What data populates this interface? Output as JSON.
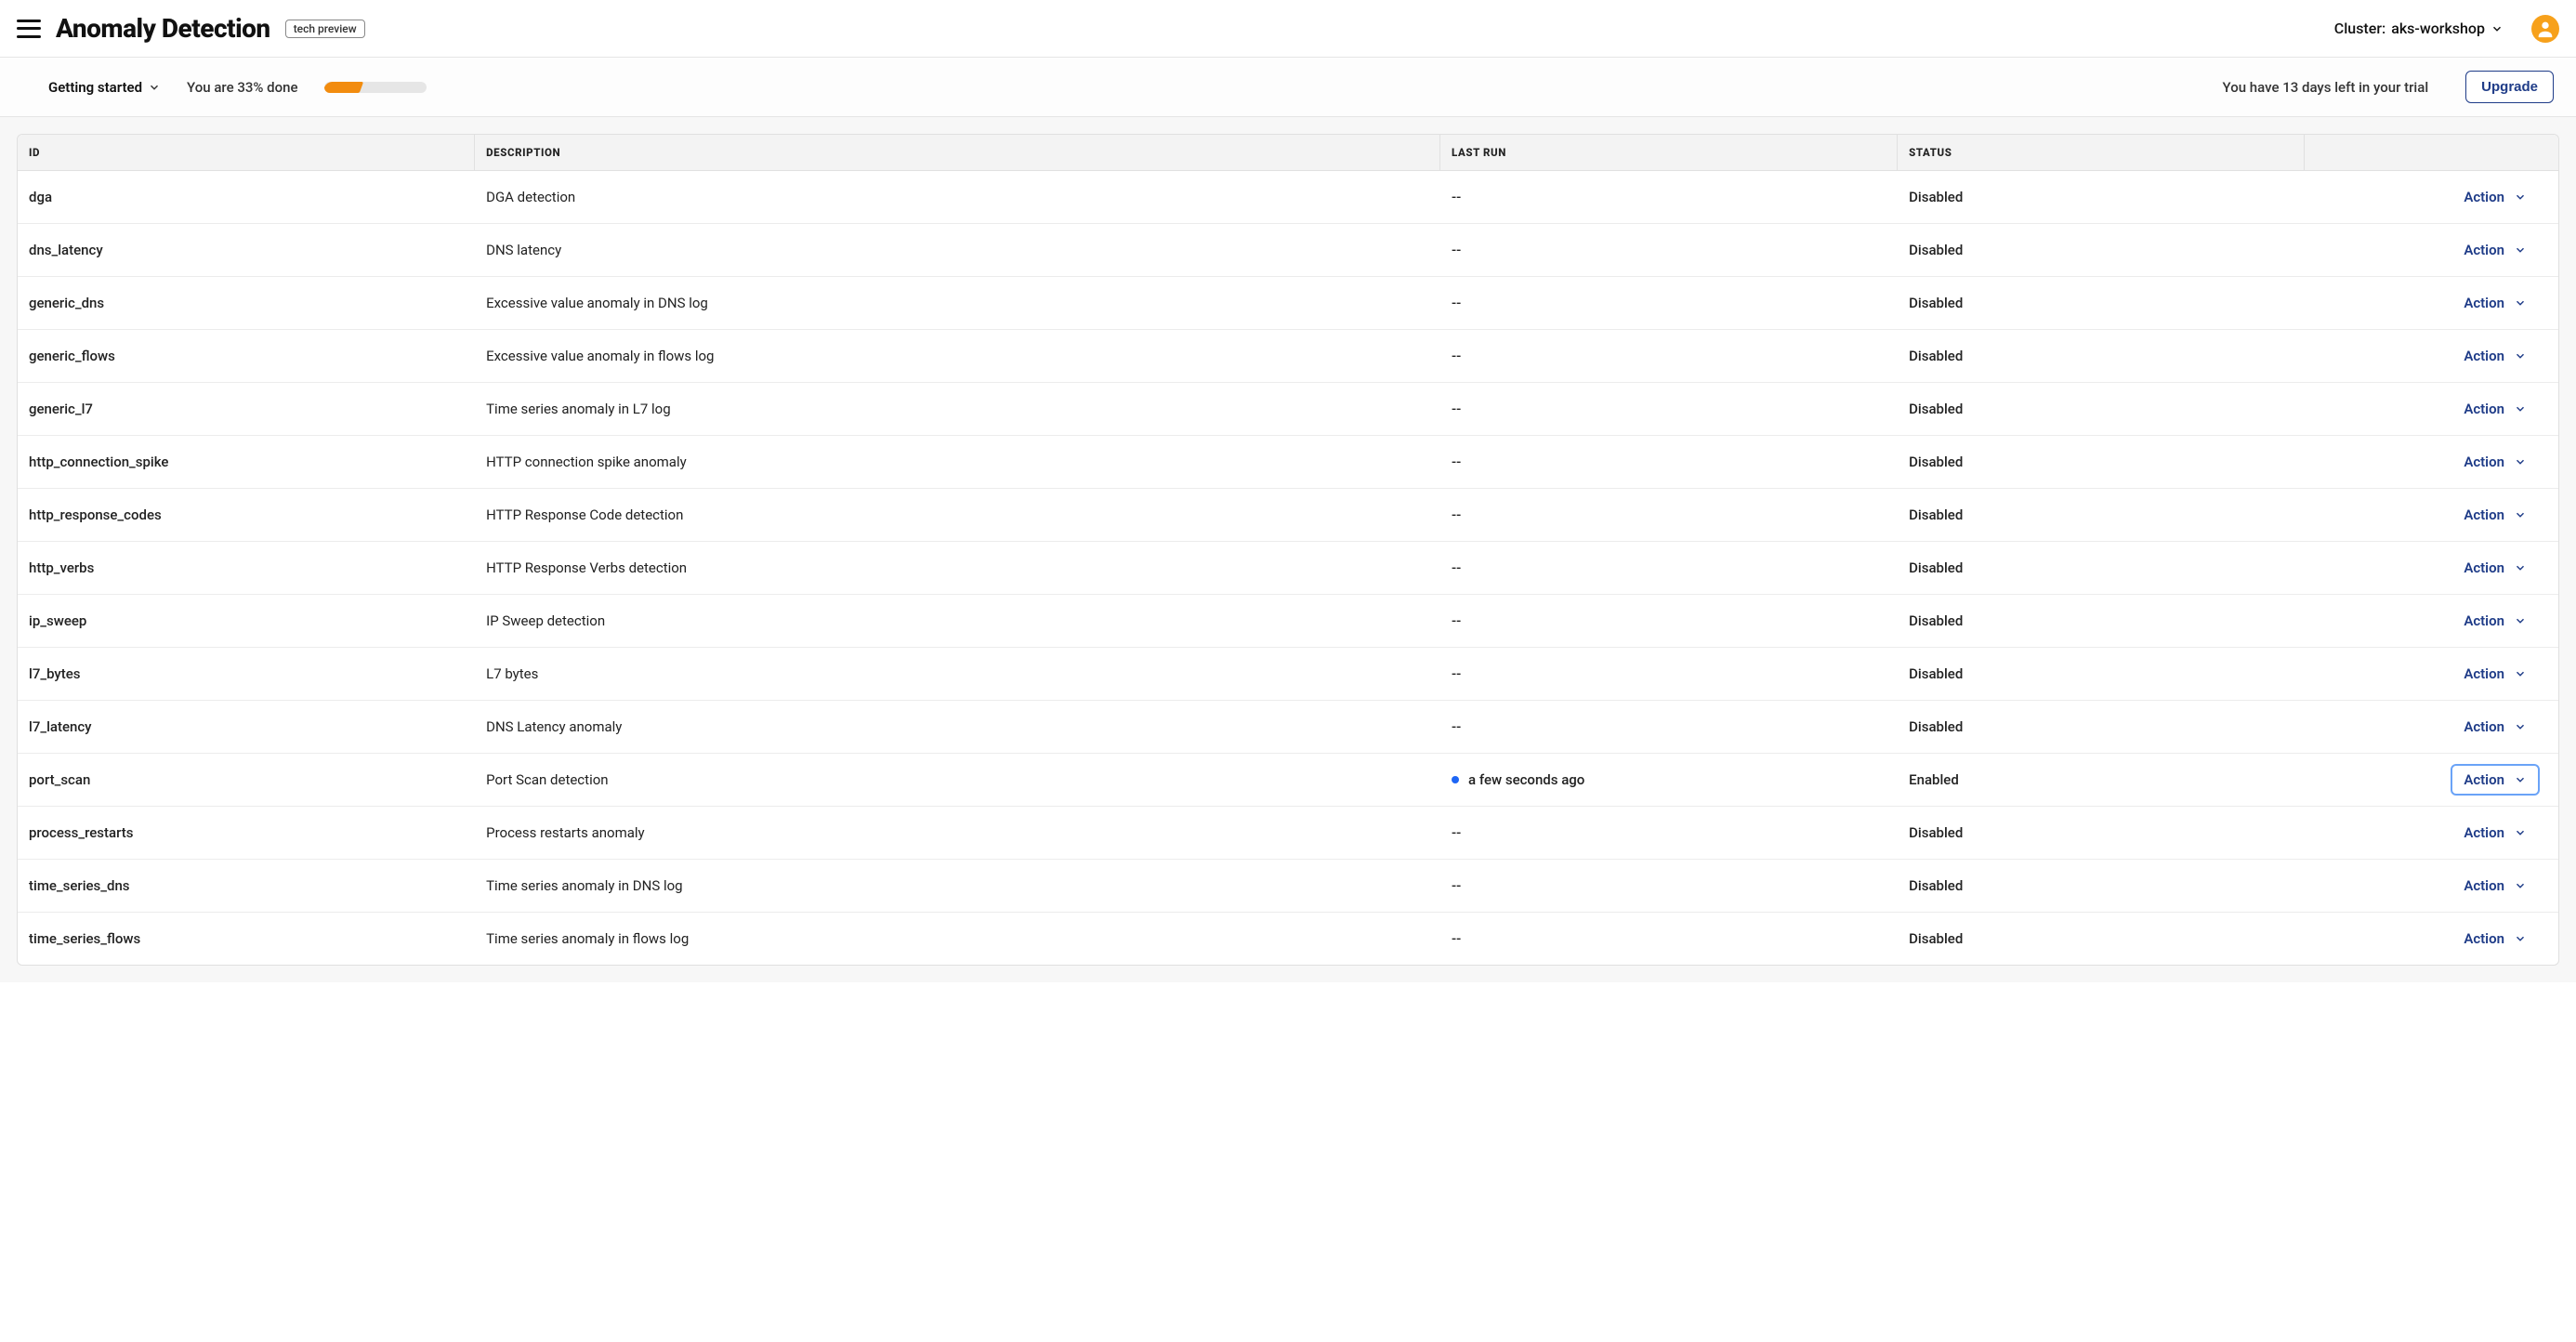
{
  "header": {
    "title": "Anomaly Detection",
    "tag": "tech preview",
    "cluster_label": "Cluster:",
    "cluster_name": "aks-workshop"
  },
  "subheader": {
    "getting_started": "Getting started",
    "progress_text": "You are 33% done",
    "progress_pct": 33,
    "trial_text": "You have 13 days left in your trial",
    "upgrade": "Upgrade"
  },
  "table": {
    "headers": {
      "id": "ID",
      "description": "DESCRIPTION",
      "last_run": "LAST RUN",
      "status": "STATUS"
    },
    "action_label": "Action",
    "rows": [
      {
        "id": "dga",
        "description": "DGA detection",
        "last_run": "--",
        "status": "Disabled",
        "has_dot": false,
        "focused": false
      },
      {
        "id": "dns_latency",
        "description": "DNS latency",
        "last_run": "--",
        "status": "Disabled",
        "has_dot": false,
        "focused": false
      },
      {
        "id": "generic_dns",
        "description": "Excessive value anomaly in DNS log",
        "last_run": "--",
        "status": "Disabled",
        "has_dot": false,
        "focused": false
      },
      {
        "id": "generic_flows",
        "description": "Excessive value anomaly in flows log",
        "last_run": "--",
        "status": "Disabled",
        "has_dot": false,
        "focused": false
      },
      {
        "id": "generic_l7",
        "description": "Time series anomaly in L7 log",
        "last_run": "--",
        "status": "Disabled",
        "has_dot": false,
        "focused": false
      },
      {
        "id": "http_connection_spike",
        "description": "HTTP connection spike anomaly",
        "last_run": "--",
        "status": "Disabled",
        "has_dot": false,
        "focused": false
      },
      {
        "id": "http_response_codes",
        "description": "HTTP Response Code detection",
        "last_run": "--",
        "status": "Disabled",
        "has_dot": false,
        "focused": false
      },
      {
        "id": "http_verbs",
        "description": "HTTP Response Verbs detection",
        "last_run": "--",
        "status": "Disabled",
        "has_dot": false,
        "focused": false
      },
      {
        "id": "ip_sweep",
        "description": "IP Sweep detection",
        "last_run": "--",
        "status": "Disabled",
        "has_dot": false,
        "focused": false
      },
      {
        "id": "l7_bytes",
        "description": "L7 bytes",
        "last_run": "--",
        "status": "Disabled",
        "has_dot": false,
        "focused": false
      },
      {
        "id": "l7_latency",
        "description": "DNS Latency anomaly",
        "last_run": "--",
        "status": "Disabled",
        "has_dot": false,
        "focused": false
      },
      {
        "id": "port_scan",
        "description": "Port Scan detection",
        "last_run": "a few seconds ago",
        "status": "Enabled",
        "has_dot": true,
        "focused": true
      },
      {
        "id": "process_restarts",
        "description": "Process restarts anomaly",
        "last_run": "--",
        "status": "Disabled",
        "has_dot": false,
        "focused": false
      },
      {
        "id": "time_series_dns",
        "description": "Time series anomaly in DNS log",
        "last_run": "--",
        "status": "Disabled",
        "has_dot": false,
        "focused": false
      },
      {
        "id": "time_series_flows",
        "description": "Time series anomaly in flows log",
        "last_run": "--",
        "status": "Disabled",
        "has_dot": false,
        "focused": false
      }
    ]
  }
}
